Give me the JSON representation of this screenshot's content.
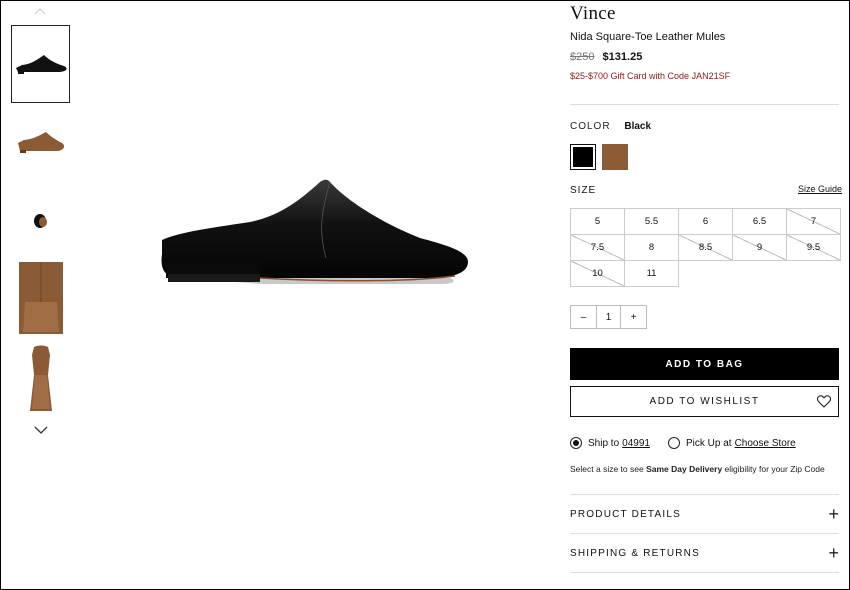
{
  "brand": "Vince",
  "product_name": "Nida Square-Toe Leather Mules",
  "price": {
    "original": "$250",
    "sale": "$131.25"
  },
  "promo": "$25-$700 Gift Card with Code JAN21SF",
  "color": {
    "label": "COLOR",
    "selected": "Black",
    "swatches": [
      "#000000",
      "#8c5c36"
    ]
  },
  "size": {
    "label": "SIZE",
    "guide_label": "Size Guide",
    "options": [
      {
        "value": "5",
        "available": true
      },
      {
        "value": "5.5",
        "available": true
      },
      {
        "value": "6",
        "available": true
      },
      {
        "value": "6.5",
        "available": true
      },
      {
        "value": "7",
        "available": false
      },
      {
        "value": "7.5",
        "available": false
      },
      {
        "value": "8",
        "available": true
      },
      {
        "value": "8.5",
        "available": false
      },
      {
        "value": "9",
        "available": false
      },
      {
        "value": "9.5",
        "available": false
      },
      {
        "value": "10",
        "available": false
      },
      {
        "value": "11",
        "available": true
      }
    ]
  },
  "quantity": {
    "minus": "–",
    "value": "1",
    "plus": "+"
  },
  "buttons": {
    "add_to_bag": "ADD TO BAG",
    "add_to_wishlist": "ADD TO WISHLIST"
  },
  "shipping": {
    "ship_to_label": "Ship to",
    "zip": "04991",
    "pickup_label": "Pick Up at",
    "store_link": "Choose Store",
    "note_prefix": "Select a size to see",
    "note_bold": "Same Day Delivery",
    "note_suffix": "eligibility for your Zip Code"
  },
  "accordions": [
    "PRODUCT DETAILS",
    "SHIPPING & RETURNS"
  ],
  "icons": [
    "chevron-up-icon",
    "chevron-down-icon",
    "heart-icon",
    "plus-icon"
  ]
}
